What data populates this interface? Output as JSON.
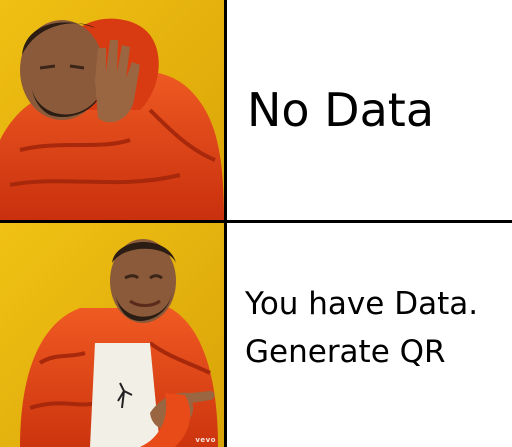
{
  "top_panel": {
    "caption": "No Data",
    "image": "man-rejecting-gesture-orange-jacket",
    "background_color": "#e8b40a",
    "jacket_color": "#e0401a"
  },
  "bottom_panel": {
    "caption_lines": [
      "You have Data.",
      "Generate QR"
    ],
    "image": "man-approving-pointing-orange-jacket",
    "background_color": "#e6b20c",
    "jacket_color": "#e84a18"
  },
  "watermark": "vevo",
  "divider_color": "#000000"
}
